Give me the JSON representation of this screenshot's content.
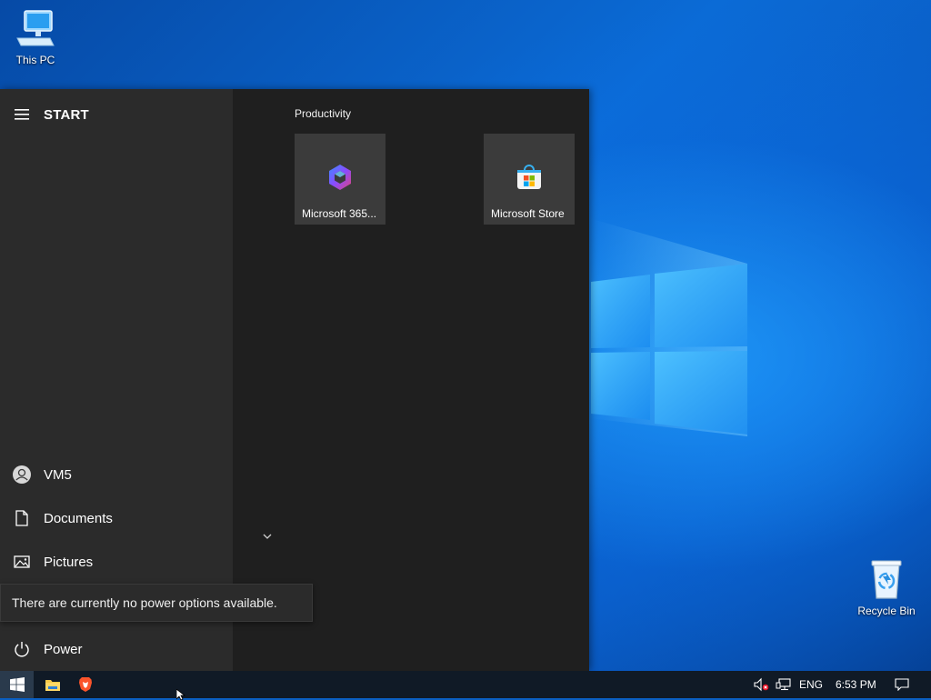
{
  "desktop": {
    "icons": [
      {
        "label": "This PC",
        "icon": "computer-icon"
      },
      {
        "label": "Recycle Bin",
        "icon": "recycle-bin-icon"
      }
    ]
  },
  "start_menu": {
    "title": "START",
    "nav": {
      "user": "VM5",
      "documents": "Documents",
      "pictures": "Pictures",
      "power": "Power"
    },
    "tooltip": "There are currently no power options available.",
    "group_title": "Productivity",
    "tiles": [
      {
        "label": "Microsoft 365...",
        "icon": "microsoft-365-icon"
      },
      {
        "label": "Microsoft Store",
        "icon": "microsoft-store-icon"
      }
    ]
  },
  "taskbar": {
    "pinned": [
      "file-explorer-icon",
      "brave-browser-icon"
    ],
    "tray": {
      "language": "ENG",
      "time": "6:53 PM"
    }
  },
  "colors": {
    "menu_bg": "#1f1f1f",
    "menu_left_bg": "#2b2b2b",
    "tile_bg": "#3b3b3b",
    "taskbar_bg": "#101a26"
  }
}
